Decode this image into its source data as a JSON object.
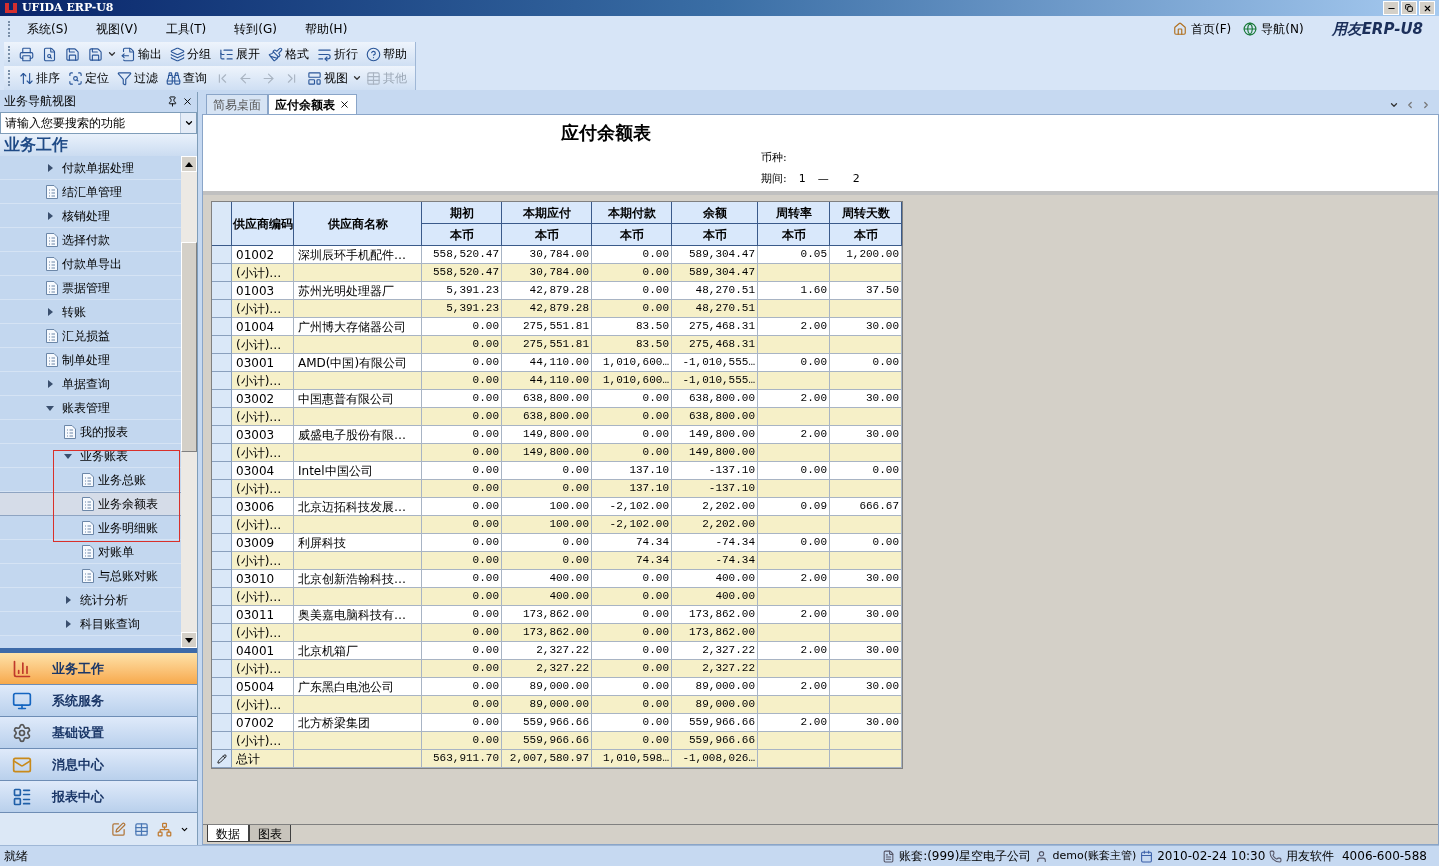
{
  "window": {
    "title": "UFIDA ERP-U8"
  },
  "menu": [
    "系统(S)",
    "视图(V)",
    "工具(T)",
    "转到(G)",
    "帮助(H)"
  ],
  "quick_links": [
    "首页(F)",
    "导航(N)"
  ],
  "brand": "用友ERP-U8",
  "toolbar_1": [
    {
      "disabled": false
    },
    {
      "disabled": false
    },
    {
      "disabled": false
    },
    {
      "disabled": false,
      "dropdown": true
    },
    {
      "label": "输出",
      "disabled": false
    },
    {
      "label": "分组",
      "disabled": false
    },
    {
      "label": "展开",
      "disabled": false
    },
    {
      "label": "格式",
      "disabled": false
    },
    {
      "label": "折行",
      "disabled": false
    },
    {
      "label": "帮助",
      "disabled": false
    }
  ],
  "toolbar_2": [
    {
      "label": "排序",
      "disabled": false
    },
    {
      "label": "定位",
      "disabled": false
    },
    {
      "label": "过滤",
      "disabled": false
    },
    {
      "label": "查询",
      "disabled": false
    },
    {
      "disabled": true
    },
    {
      "disabled": true
    },
    {
      "disabled": true
    },
    {
      "disabled": true
    },
    {
      "label": "视图",
      "disabled": false,
      "dropdown": true
    },
    {
      "label": "其他",
      "disabled": true
    }
  ],
  "sidebar": {
    "title": "业务导航视图",
    "search": {
      "placeholder": "请输入您要搜索的功能"
    },
    "section": "业务工作",
    "tree": [
      {
        "label": "付款单据处理",
        "kind": "folder",
        "expanded": false,
        "selected": false
      },
      {
        "label": "结汇单管理",
        "kind": "doc",
        "selected": false
      },
      {
        "label": "核销处理",
        "kind": "folder",
        "expanded": false,
        "selected": false
      },
      {
        "label": "选择付款",
        "kind": "doc",
        "selected": false
      },
      {
        "label": "付款单导出",
        "kind": "doc",
        "selected": false
      },
      {
        "label": "票据管理",
        "kind": "doc",
        "selected": false
      },
      {
        "label": "转账",
        "kind": "folder",
        "expanded": false,
        "selected": false
      },
      {
        "label": "汇兑损益",
        "kind": "doc",
        "selected": false
      },
      {
        "label": "制单处理",
        "kind": "doc",
        "selected": false
      },
      {
        "label": "单据查询",
        "kind": "folder",
        "expanded": false,
        "selected": false
      },
      {
        "label": "账表管理",
        "kind": "folder",
        "expanded": true,
        "selected": false,
        "children": [
          {
            "label": "我的报表",
            "kind": "doc",
            "selected": false
          },
          {
            "label": "业务账表",
            "kind": "folder",
            "expanded": true,
            "selected": false,
            "children": [
              {
                "label": "业务总账",
                "kind": "doc",
                "selected": false
              },
              {
                "label": "业务余额表",
                "kind": "doc",
                "selected": true
              },
              {
                "label": "业务明细账",
                "kind": "doc",
                "selected": false
              },
              {
                "label": "对账单",
                "kind": "doc",
                "selected": false
              },
              {
                "label": "与总账对账",
                "kind": "doc",
                "selected": false
              }
            ]
          },
          {
            "label": "统计分析",
            "kind": "folder",
            "expanded": false,
            "selected": false
          },
          {
            "label": "科目账查询",
            "kind": "folder",
            "expanded": false,
            "selected": false
          }
        ]
      }
    ],
    "nav_buttons": [
      {
        "label": "业务工作",
        "selected": true
      },
      {
        "label": "系统服务",
        "selected": false
      },
      {
        "label": "基础设置",
        "selected": false
      },
      {
        "label": "消息中心",
        "selected": false
      },
      {
        "label": "报表中心",
        "selected": false
      }
    ]
  },
  "tabs": [
    {
      "label": "简易桌面",
      "selected": false
    },
    {
      "label": "应付余额表",
      "selected": true,
      "closable": true
    }
  ],
  "report": {
    "title": "应付余额表",
    "currency_label": "币种:",
    "period_label": "期间:",
    "period_from": "1",
    "period_sep": "—",
    "period_to": "2"
  },
  "table": {
    "columns": [
      {
        "label": "供应商编码"
      },
      {
        "label": "供应商名称"
      },
      {
        "label": "期初",
        "sub": "本币"
      },
      {
        "label": "本期应付",
        "sub": "本币"
      },
      {
        "label": "本期付款",
        "sub": "本币"
      },
      {
        "label": "余额",
        "sub": "本币"
      },
      {
        "label": "周转率",
        "sub": "本币"
      },
      {
        "label": "周转天数",
        "sub": "本币"
      }
    ],
    "rows": [
      {
        "kind": "detail",
        "code": "01002",
        "name": "深圳辰环手机配件…",
        "opening": "558,520.47",
        "payable": "30,784.00",
        "paid": "0.00",
        "balance": "589,304.47",
        "rate": "0.05",
        "days": "1,200.00"
      },
      {
        "kind": "subtotal",
        "code": "(小计)…",
        "opening": "558,520.47",
        "payable": "30,784.00",
        "paid": "0.00",
        "balance": "589,304.47"
      },
      {
        "kind": "detail",
        "code": "01003",
        "name": "苏州光明处理器厂",
        "opening": "5,391.23",
        "payable": "42,879.28",
        "paid": "0.00",
        "balance": "48,270.51",
        "rate": "1.60",
        "days": "37.50"
      },
      {
        "kind": "subtotal",
        "code": "(小计)…",
        "opening": "5,391.23",
        "payable": "42,879.28",
        "paid": "0.00",
        "balance": "48,270.51"
      },
      {
        "kind": "detail",
        "code": "01004",
        "name": "广州博大存储器公司",
        "opening": "0.00",
        "payable": "275,551.81",
        "paid": "83.50",
        "balance": "275,468.31",
        "rate": "2.00",
        "days": "30.00"
      },
      {
        "kind": "subtotal",
        "code": "(小计)…",
        "opening": "0.00",
        "payable": "275,551.81",
        "paid": "83.50",
        "balance": "275,468.31"
      },
      {
        "kind": "detail",
        "code": "03001",
        "name": "AMD(中国)有限公司",
        "opening": "0.00",
        "payable": "44,110.00",
        "paid": "1,010,600…",
        "balance": "-1,010,555…",
        "rate": "0.00",
        "days": "0.00"
      },
      {
        "kind": "subtotal",
        "code": "(小计)…",
        "opening": "0.00",
        "payable": "44,110.00",
        "paid": "1,010,600…",
        "balance": "-1,010,555…"
      },
      {
        "kind": "detail",
        "code": "03002",
        "name": "中国惠普有限公司",
        "opening": "0.00",
        "payable": "638,800.00",
        "paid": "0.00",
        "balance": "638,800.00",
        "rate": "2.00",
        "days": "30.00"
      },
      {
        "kind": "subtotal",
        "code": "(小计)…",
        "opening": "0.00",
        "payable": "638,800.00",
        "paid": "0.00",
        "balance": "638,800.00"
      },
      {
        "kind": "detail",
        "code": "03003",
        "name": "威盛电子股份有限…",
        "opening": "0.00",
        "payable": "149,800.00",
        "paid": "0.00",
        "balance": "149,800.00",
        "rate": "2.00",
        "days": "30.00"
      },
      {
        "kind": "subtotal",
        "code": "(小计)…",
        "opening": "0.00",
        "payable": "149,800.00",
        "paid": "0.00",
        "balance": "149,800.00"
      },
      {
        "kind": "detail",
        "code": "03004",
        "name": "Intel中国公司",
        "opening": "0.00",
        "payable": "0.00",
        "paid": "137.10",
        "balance": "-137.10",
        "rate": "0.00",
        "days": "0.00"
      },
      {
        "kind": "subtotal",
        "code": "(小计)…",
        "opening": "0.00",
        "payable": "0.00",
        "paid": "137.10",
        "balance": "-137.10"
      },
      {
        "kind": "detail",
        "code": "03006",
        "name": "北京迈拓科技发展…",
        "opening": "0.00",
        "payable": "100.00",
        "paid": "-2,102.00",
        "balance": "2,202.00",
        "rate": "0.09",
        "days": "666.67"
      },
      {
        "kind": "subtotal",
        "code": "(小计)…",
        "opening": "0.00",
        "payable": "100.00",
        "paid": "-2,102.00",
        "balance": "2,202.00"
      },
      {
        "kind": "detail",
        "code": "03009",
        "name": "利屏科技",
        "opening": "0.00",
        "payable": "0.00",
        "paid": "74.34",
        "balance": "-74.34",
        "rate": "0.00",
        "days": "0.00"
      },
      {
        "kind": "subtotal",
        "code": "(小计)…",
        "opening": "0.00",
        "payable": "0.00",
        "paid": "74.34",
        "balance": "-74.34"
      },
      {
        "kind": "detail",
        "code": "03010",
        "name": "北京创新浩翰科技…",
        "opening": "0.00",
        "payable": "400.00",
        "paid": "0.00",
        "balance": "400.00",
        "rate": "2.00",
        "days": "30.00"
      },
      {
        "kind": "subtotal",
        "code": "(小计)…",
        "opening": "0.00",
        "payable": "400.00",
        "paid": "0.00",
        "balance": "400.00"
      },
      {
        "kind": "detail",
        "code": "03011",
        "name": "奥美嘉电脑科技有…",
        "opening": "0.00",
        "payable": "173,862.00",
        "paid": "0.00",
        "balance": "173,862.00",
        "rate": "2.00",
        "days": "30.00"
      },
      {
        "kind": "subtotal",
        "code": "(小计)…",
        "opening": "0.00",
        "payable": "173,862.00",
        "paid": "0.00",
        "balance": "173,862.00"
      },
      {
        "kind": "detail",
        "code": "04001",
        "name": "北京机箱厂",
        "opening": "0.00",
        "payable": "2,327.22",
        "paid": "0.00",
        "balance": "2,327.22",
        "rate": "2.00",
        "days": "30.00"
      },
      {
        "kind": "subtotal",
        "code": "(小计)…",
        "opening": "0.00",
        "payable": "2,327.22",
        "paid": "0.00",
        "balance": "2,327.22"
      },
      {
        "kind": "detail",
        "code": "05004",
        "name": "广东黑白电池公司",
        "opening": "0.00",
        "payable": "89,000.00",
        "paid": "0.00",
        "balance": "89,000.00",
        "rate": "2.00",
        "days": "30.00"
      },
      {
        "kind": "subtotal",
        "code": "(小计)…",
        "opening": "0.00",
        "payable": "89,000.00",
        "paid": "0.00",
        "balance": "89,000.00"
      },
      {
        "kind": "detail",
        "code": "07002",
        "name": "北方桥梁集团",
        "opening": "0.00",
        "payable": "559,966.66",
        "paid": "0.00",
        "balance": "559,966.66",
        "rate": "2.00",
        "days": "30.00"
      },
      {
        "kind": "subtotal",
        "code": "(小计)…",
        "opening": "0.00",
        "payable": "559,966.66",
        "paid": "0.00",
        "balance": "559,966.66"
      },
      {
        "kind": "total",
        "code": "总计",
        "opening": "563,911.70",
        "payable": "2,007,580.97",
        "paid": "1,010,598…",
        "balance": "-1,008,026…"
      }
    ]
  },
  "sheet_tabs": [
    {
      "label": "数据",
      "selected": true
    },
    {
      "label": "图表",
      "selected": false
    }
  ],
  "status_bar": {
    "message": "就绪",
    "account": "账套:(999)星空电子公司",
    "user": "demo(账套主管)",
    "datetime": "2010-02-24 10:30",
    "vendor": "用友软件  4006-600-588"
  }
}
